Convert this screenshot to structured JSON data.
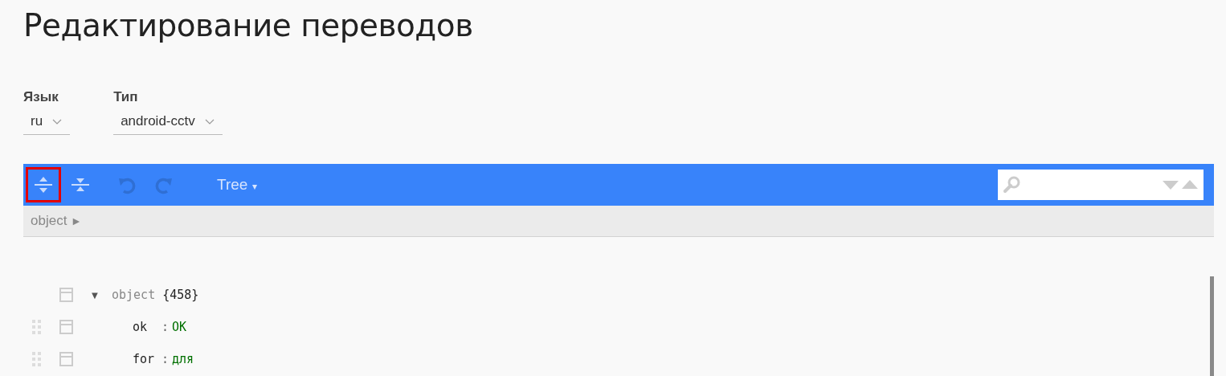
{
  "page_title": "Редактирование переводов",
  "filters": [
    {
      "label": "Язык",
      "value": "ru"
    },
    {
      "label": "Тип",
      "value": "android-cctv"
    }
  ],
  "toolbar": {
    "buttons": [
      {
        "kind": "expand",
        "focused": true,
        "disabled": false
      },
      {
        "kind": "collapse",
        "focused": false,
        "disabled": false
      },
      {
        "kind": "undo",
        "focused": false,
        "disabled": true
      },
      {
        "kind": "redo",
        "focused": false,
        "disabled": true
      }
    ],
    "mode": "Tree",
    "mode_caret": "▾"
  },
  "breadcrumb": [
    {
      "label": "object",
      "arrow": "►"
    }
  ],
  "tree": {
    "key": "object",
    "count": "{458}",
    "expanded": true,
    "toggle": "▼",
    "children": [
      {
        "key": "ok",
        "separator": ":",
        "value": "OK"
      },
      {
        "key": "for",
        "separator": ":",
        "value": "для"
      }
    ]
  }
}
